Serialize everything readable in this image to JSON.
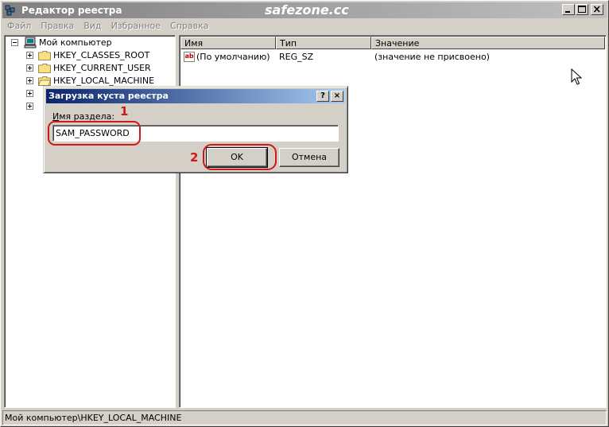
{
  "window": {
    "title": "Редактор реестра",
    "watermark": "safezone.cc"
  },
  "menu": [
    "Файл",
    "Правка",
    "Вид",
    "Избранное",
    "Справка"
  ],
  "tree": {
    "root": "Мой компьютер",
    "items": [
      "HKEY_CLASSES_ROOT",
      "HKEY_CURRENT_USER",
      "HKEY_LOCAL_MACHINE"
    ]
  },
  "list": {
    "columns": [
      "Имя",
      "Тип",
      "Значение"
    ],
    "rows": [
      {
        "name": "(По умолчанию)",
        "type": "REG_SZ",
        "value": "(значение не присвоено)"
      }
    ]
  },
  "statusbar": {
    "path": "Мой компьютер\\HKEY_LOCAL_MACHINE"
  },
  "dialog": {
    "title": "Загрузка куста реестра",
    "help_label": "?",
    "close_label": "×",
    "field_label_underlined": "И",
    "field_label_rest": "мя раздела:",
    "field_value": "SAM_PASSWORD",
    "ok_label": "OK",
    "cancel_label": "Отмена"
  },
  "annotations": {
    "step1": "1",
    "step2": "2",
    "color": "#d01818"
  },
  "icons": {
    "title": "registry-editor-icon",
    "computer": "computer-icon",
    "folder": "folder-icon",
    "string_value": "string-value-ab-icon",
    "pointer": "mouse-pointer-icon"
  }
}
